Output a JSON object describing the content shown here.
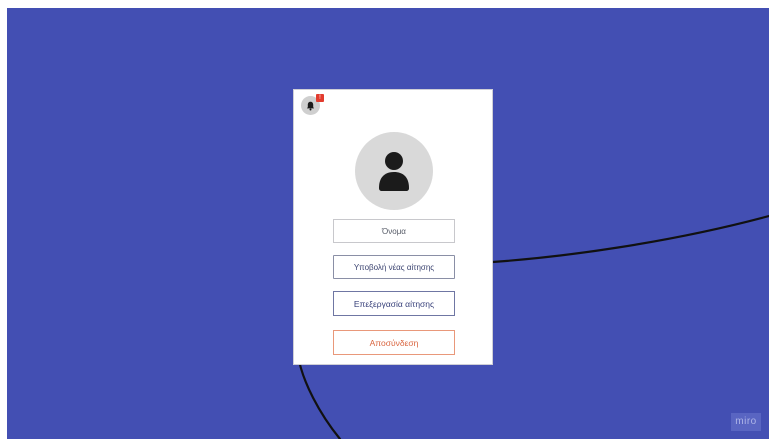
{
  "profile": {
    "name_placeholder": "Όνομα",
    "notification_count": "!"
  },
  "actions": {
    "new_application": "Υποβολή νέας αίτησης",
    "edit_application": "Επεξεργασία αίτησης",
    "logout": "Αποσύνδεση"
  },
  "branding": {
    "logo_text": "miro"
  },
  "colors": {
    "board_background": "#434fb3",
    "logout_accent": "#d9643e",
    "badge": "#e23b2e",
    "connector": "#111111"
  },
  "icons": {
    "bell": "bell-icon",
    "avatar": "user-avatar-icon"
  }
}
